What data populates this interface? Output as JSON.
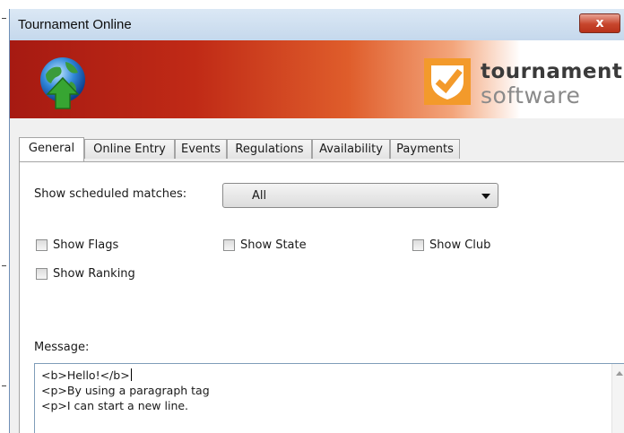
{
  "window": {
    "title": "Tournament Online",
    "close_label": "x"
  },
  "banner": {
    "brand_line1": "tournament",
    "brand_line2": "software"
  },
  "tabs": [
    {
      "label": "General",
      "active": true
    },
    {
      "label": "Online Entry",
      "active": false
    },
    {
      "label": "Events",
      "active": false
    },
    {
      "label": "Regulations",
      "active": false
    },
    {
      "label": "Availability",
      "active": false
    },
    {
      "label": "Payments",
      "active": false
    }
  ],
  "general": {
    "scheduled_label": "Show scheduled matches:",
    "scheduled_value": "All",
    "checkboxes": {
      "flags": {
        "label": "Show Flags",
        "checked": false
      },
      "state": {
        "label": "Show State",
        "checked": false
      },
      "club": {
        "label": "Show Club",
        "checked": false
      },
      "ranking": {
        "label": "Show Ranking",
        "checked": false
      }
    },
    "message_label": "Message:",
    "message_lines": [
      "<b>Hello!</b>",
      "<p>By using a paragraph tag",
      "<p>I can start a new line."
    ]
  },
  "colors": {
    "banner_red": "#a61a12",
    "logo_orange": "#f39a2b",
    "close_red": "#c7452c"
  }
}
